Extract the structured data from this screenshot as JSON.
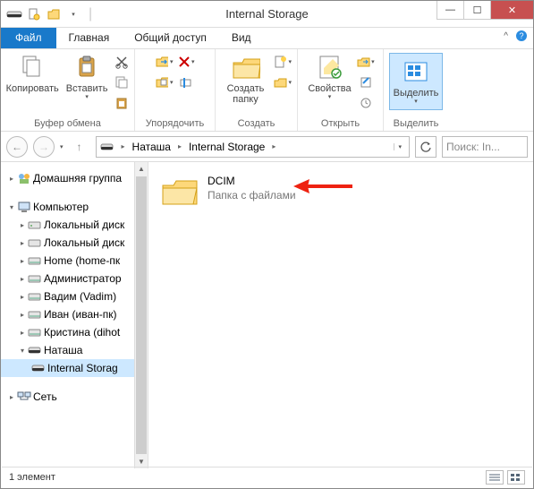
{
  "window": {
    "title": "Internal Storage"
  },
  "tabs": {
    "file": "Файл",
    "home": "Главная",
    "share": "Общий доступ",
    "view": "Вид"
  },
  "ribbon": {
    "copy": "Копировать",
    "paste": "Вставить",
    "clipboard_group": "Буфер обмена",
    "organize_group": "Упорядочить",
    "new_folder": "Создать папку",
    "new_group": "Создать",
    "properties": "Свойства",
    "open_group": "Открыть",
    "select": "Выделить",
    "select_group": "Выделить"
  },
  "nav": {
    "crumb1": "Наташа",
    "crumb2": "Internal Storage",
    "search_placeholder": "Поиск: In..."
  },
  "tree": {
    "homegroup": "Домашняя группа",
    "computer": "Компьютер",
    "local1": "Локальный диск",
    "local2": "Локальный диск",
    "home": "Home (home-пк",
    "admin": "Администратор",
    "vadim": "Вадим (Vadim)",
    "ivan": "Иван (иван-пк)",
    "kristina": "Кристина (dihot",
    "natasha": "Наташа",
    "internal": "Internal Storag",
    "network": "Сеть"
  },
  "content": {
    "item_name": "DCIM",
    "item_type": "Папка с файлами"
  },
  "status": {
    "count": "1 элемент"
  }
}
